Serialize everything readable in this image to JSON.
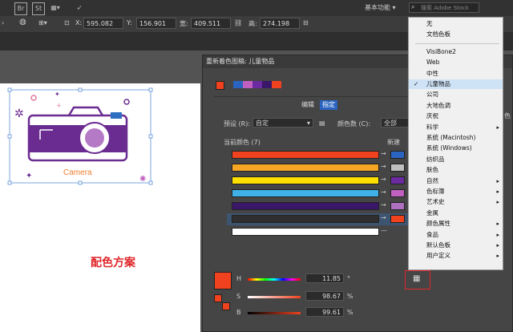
{
  "topbar": {
    "br_label": "Br",
    "st_label": "St",
    "workspace": "基本功能",
    "search_placeholder": "搜索 Adobe Stock"
  },
  "controlbar": {
    "x_label": "X:",
    "x_value": "595.082",
    "y_label": "Y:",
    "y_value": "156.901",
    "w_label": "宽:",
    "w_value": "409.511",
    "h_label": "高:",
    "h_value": "274.198"
  },
  "artwork": {
    "camera_text": "Camera",
    "scheme_caption": "配色方案"
  },
  "dialog": {
    "title": "重新着色图稿: 儿童物品",
    "tab_edit": "编辑",
    "tab_assign": "指定",
    "preset_label": "预设 (R):",
    "preset_value": "自定",
    "colors_label": "颜色数 (C):",
    "colors_value": "全部",
    "current_colors_label": "当前颜色 (7)",
    "new_label": "新建",
    "side_label": "色",
    "hsb": {
      "h_label": "H",
      "h_value": "11.85",
      "h_unit": "°",
      "s_label": "S",
      "s_value": "98.67",
      "s_unit": "%",
      "b_label": "B",
      "b_value": "99.61",
      "b_unit": "%"
    },
    "color_rows": [
      "#f0421e",
      "#f5a623",
      "#fde000",
      "#3fb0e8",
      "#3a1768",
      "#2f2f2f",
      "#ffffff"
    ],
    "new_swatches": [
      "#2a64c0",
      "#c0c0c0",
      "#6b2aa0",
      "#c060c0",
      "#b070c0",
      "#f0421e",
      ""
    ]
  },
  "menu": {
    "items": [
      {
        "label": "无"
      },
      {
        "label": "文档色板"
      },
      {
        "label": "VisiBone2"
      },
      {
        "label": "Web"
      },
      {
        "label": "中性"
      },
      {
        "label": "儿童物品",
        "checked": true
      },
      {
        "label": "公司"
      },
      {
        "label": "大地色调"
      },
      {
        "label": "庆祝"
      },
      {
        "label": "科学",
        "submenu": true
      },
      {
        "label": "系统 (Macintosh)"
      },
      {
        "label": "系统 (Windows)"
      },
      {
        "label": "纺织品"
      },
      {
        "label": "肤色"
      },
      {
        "label": "自然",
        "submenu": true
      },
      {
        "label": "色标簿",
        "submenu": true
      },
      {
        "label": "艺术史",
        "submenu": true
      },
      {
        "label": "金属"
      },
      {
        "label": "颜色属性",
        "submenu": true
      },
      {
        "label": "食品",
        "submenu": true
      },
      {
        "label": "默认色板",
        "submenu": true
      },
      {
        "label": "用户定义",
        "submenu": true
      }
    ]
  }
}
